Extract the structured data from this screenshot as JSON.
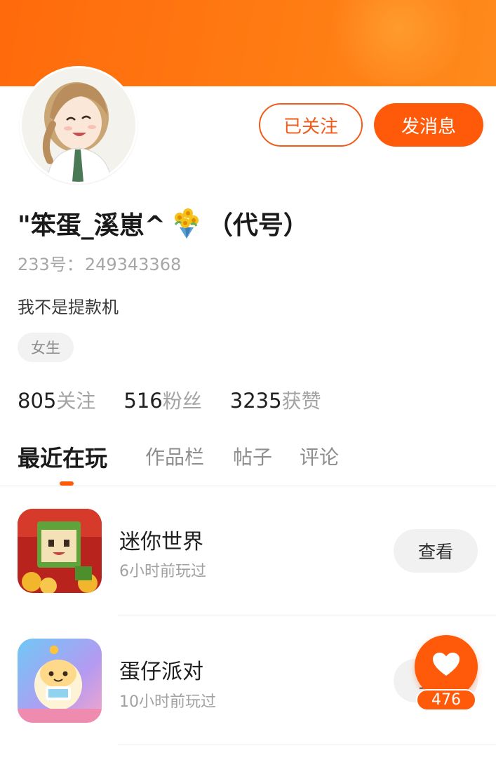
{
  "profile": {
    "nickname_text": "\"笨蛋_溪崽^",
    "nickname_suffix": "（代号）",
    "uid_label": "233号：",
    "uid_value": "249343368",
    "bio": "我不是提款机",
    "gender": "女生"
  },
  "actions": {
    "followed_label": "已关注",
    "message_label": "发消息"
  },
  "stats": [
    {
      "value": "805",
      "label": "关注"
    },
    {
      "value": "516",
      "label": "粉丝"
    },
    {
      "value": "3235",
      "label": "获赞"
    }
  ],
  "tabs": [
    {
      "label": "最近在玩",
      "active": true
    },
    {
      "label": "作品栏",
      "active": false
    },
    {
      "label": "帖子",
      "active": false
    },
    {
      "label": "评论",
      "active": false
    }
  ],
  "games": [
    {
      "title": "迷你世界",
      "time": "6小时前玩过",
      "action": "查看"
    },
    {
      "title": "蛋仔派对",
      "time": "10小时前玩过",
      "action": "查看"
    }
  ],
  "like": {
    "count": "476"
  },
  "colors": {
    "accent": "#ff5a0a",
    "banner": "#ff7b12"
  }
}
